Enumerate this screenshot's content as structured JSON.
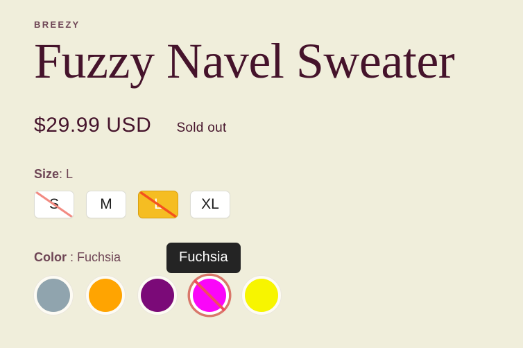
{
  "product": {
    "vendor": "BREEZY",
    "title": "Fuzzy Navel Sweater",
    "price": "$29.99 USD",
    "availability": "Sold out"
  },
  "size_option": {
    "legend_name": "Size",
    "legend_value": ": L",
    "selected": "L",
    "values": [
      {
        "label": "S",
        "sold_out": true,
        "selected": false
      },
      {
        "label": "M",
        "sold_out": false,
        "selected": false
      },
      {
        "label": "L",
        "sold_out": true,
        "selected": true
      },
      {
        "label": "XL",
        "sold_out": false,
        "selected": false
      }
    ]
  },
  "color_option": {
    "legend_name": "Color",
    "legend_value": " : Fuchsia",
    "selected": "Fuchsia",
    "tooltip": "Fuchsia",
    "values": [
      {
        "label": "Slate",
        "hex": "#90a4ae",
        "sold_out": false,
        "selected": false
      },
      {
        "label": "Orange",
        "hex": "#ffa401",
        "sold_out": false,
        "selected": false
      },
      {
        "label": "Purple",
        "hex": "#7b0a78",
        "sold_out": false,
        "selected": false
      },
      {
        "label": "Fuchsia",
        "hex": "#fa06f9",
        "sold_out": true,
        "selected": true
      },
      {
        "label": "Yellow",
        "hex": "#f7f500",
        "sold_out": false,
        "selected": false
      }
    ]
  },
  "colors": {
    "background": "#f0eedb",
    "title": "#45132b",
    "label": "#6e4555",
    "selected_size_bg": "#f5bd22",
    "sold_out_strike": "#f28b82",
    "selected_ring": "#d9776a",
    "tooltip_bg": "#242424"
  }
}
